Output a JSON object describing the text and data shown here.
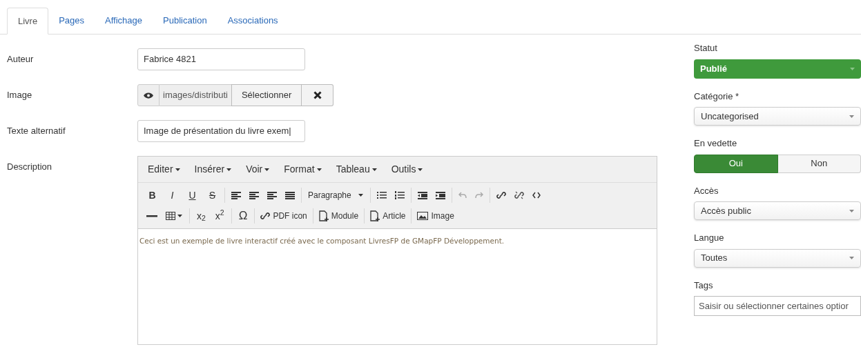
{
  "tabs": [
    {
      "label": "Livre",
      "selected": true
    },
    {
      "label": "Pages",
      "selected": false
    },
    {
      "label": "Affichage",
      "selected": false
    },
    {
      "label": "Publication",
      "selected": false
    },
    {
      "label": "Associations",
      "selected": false
    }
  ],
  "fields": {
    "author": {
      "label": "Auteur",
      "value": "Fabrice 4821"
    },
    "image": {
      "label": "Image",
      "value": "images/distributi",
      "select_button": "Sélectionner"
    },
    "alt_text": {
      "label": "Texte alternatif",
      "value": "Image de présentation du livre exem|"
    },
    "description": {
      "label": "Description"
    }
  },
  "editor": {
    "menus": [
      "Editer",
      "Insérer",
      "Voir",
      "Format",
      "Tableau",
      "Outils"
    ],
    "format_buttons": [
      "B",
      "I",
      "U",
      "S"
    ],
    "block_format": "Paragraphe",
    "special_char": "Ω",
    "subscript": "x$_{2}$",
    "superscript": "x$^{2}$",
    "plugin_buttons": [
      "PDF icon",
      "Module",
      "Article",
      "Image"
    ],
    "content": "Ceci est un exemple de livre interactif créé avec le composant LivresFP de GMapFP Développement."
  },
  "sidebar": {
    "status": {
      "label": "Statut",
      "value": "Publié"
    },
    "category": {
      "label": "Catégorie *",
      "value": "Uncategorised"
    },
    "featured": {
      "label": "En vedette",
      "options": [
        {
          "label": "Oui",
          "selected": true
        },
        {
          "label": "Non",
          "selected": false
        }
      ]
    },
    "access": {
      "label": "Accès",
      "value": "Accès public"
    },
    "language": {
      "label": "Langue",
      "value": "Toutes"
    },
    "tags": {
      "label": "Tags",
      "placeholder": "Saisir ou sélectionner certaines optior"
    }
  }
}
